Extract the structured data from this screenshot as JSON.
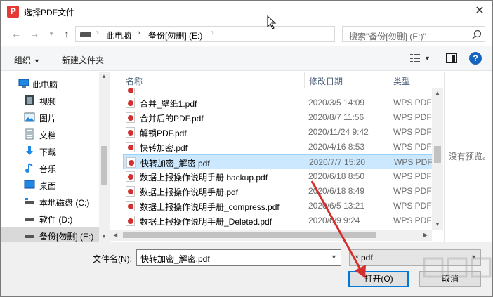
{
  "window": {
    "title": "选择PDF文件",
    "app_icon_letter": "P"
  },
  "address": {
    "crumbs": [
      "此电脑",
      "备份[勿删] (E:)"
    ]
  },
  "search": {
    "placeholder": "搜索\"备份[勿删] (E:)\""
  },
  "toolbar": {
    "organize_label": "组织",
    "new_folder_label": "新建文件夹"
  },
  "navpane": {
    "items": [
      {
        "label": "此电脑",
        "icon": "computer-icon"
      },
      {
        "label": "视频",
        "icon": "video-icon"
      },
      {
        "label": "图片",
        "icon": "picture-icon"
      },
      {
        "label": "文档",
        "icon": "document-icon"
      },
      {
        "label": "下载",
        "icon": "download-icon"
      },
      {
        "label": "音乐",
        "icon": "music-icon"
      },
      {
        "label": "桌面",
        "icon": "desktop-icon"
      },
      {
        "label": "本地磁盘 (C:)",
        "icon": "drive-icon"
      },
      {
        "label": "软件 (D:)",
        "icon": "drive-icon"
      },
      {
        "label": "备份[勿删] (E:)",
        "icon": "drive-icon",
        "selected": true
      }
    ]
  },
  "filelist": {
    "columns": {
      "name": "名称",
      "date": "修改日期",
      "type": "类型"
    },
    "rows": [
      {
        "name": "合并_壁纸1.pdf",
        "date": "2020/3/5 14:09",
        "type": "WPS PDF"
      },
      {
        "name": "合并后的PDF.pdf",
        "date": "2020/8/7 11:56",
        "type": "WPS PDF"
      },
      {
        "name": "解锁PDF.pdf",
        "date": "2020/11/24 9:42",
        "type": "WPS PDF"
      },
      {
        "name": "快转加密.pdf",
        "date": "2020/4/16 8:53",
        "type": "WPS PDF"
      },
      {
        "name": "快转加密_解密.pdf",
        "date": "2020/7/7 15:20",
        "type": "WPS PDF",
        "selected": true
      },
      {
        "name": "数据上报操作说明手册 backup.pdf",
        "date": "2020/6/18 8:50",
        "type": "WPS PDF"
      },
      {
        "name": "数据上报操作说明手册.pdf",
        "date": "2020/6/18 8:49",
        "type": "WPS PDF"
      },
      {
        "name": "数据上报操作说明手册_compress.pdf",
        "date": "2020/6/5 13:21",
        "type": "WPS PDF"
      },
      {
        "name": "数据上报操作说明手册_Deleted.pdf",
        "date": "2020/6/9 9:24",
        "type": "WPS PDF"
      }
    ]
  },
  "preview": {
    "empty_text": "没有预览。"
  },
  "bottom": {
    "filename_label": "文件名(N):",
    "filename_value": "快转加密_解密.pdf",
    "filetype_value": "*.pdf",
    "open_label": "打开(O)",
    "cancel_label": "取消"
  },
  "colors": {
    "accent": "#0078d7",
    "selection": "#cce8ff",
    "annotation": "#d32f2f",
    "pdf_icon": "#d32f2f"
  }
}
